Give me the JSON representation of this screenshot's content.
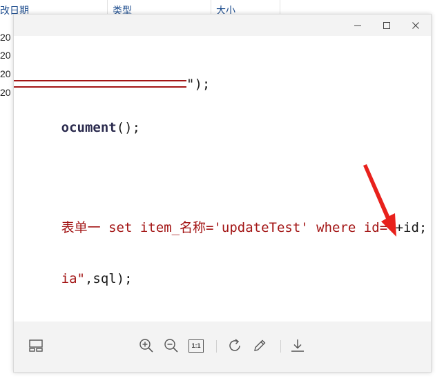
{
  "explorer": {
    "columns": [
      "改日期",
      "类型",
      "大小"
    ],
    "rows": [
      "20",
      "20",
      "20",
      "20"
    ]
  },
  "viewer": {
    "window_controls": {
      "minimize_icon": "minimize-icon",
      "maximize_icon": "maximize-icon",
      "close_icon": "close-icon"
    },
    "code": {
      "line1_tail": "\");",
      "line2_bold": "ocument",
      "line2_tail": "();",
      "line3_red": "表单一 set item_名称='updateTest' where id=\"",
      "line3_dark": "+id;",
      "line4_red": "ia\"",
      "line4_dark": ",sql);"
    },
    "toolbar": {
      "items": [
        {
          "icon": "layout-icon"
        },
        {
          "icon": "zoom-in-icon"
        },
        {
          "icon": "zoom-out-icon"
        },
        {
          "icon": "actual-size-icon",
          "label": "1:1"
        },
        {
          "icon": "rotate-icon"
        },
        {
          "icon": "edit-pen-icon"
        },
        {
          "icon": "download-icon"
        }
      ]
    },
    "annotation_color": "#e8211c",
    "code_red": "#a31515"
  }
}
